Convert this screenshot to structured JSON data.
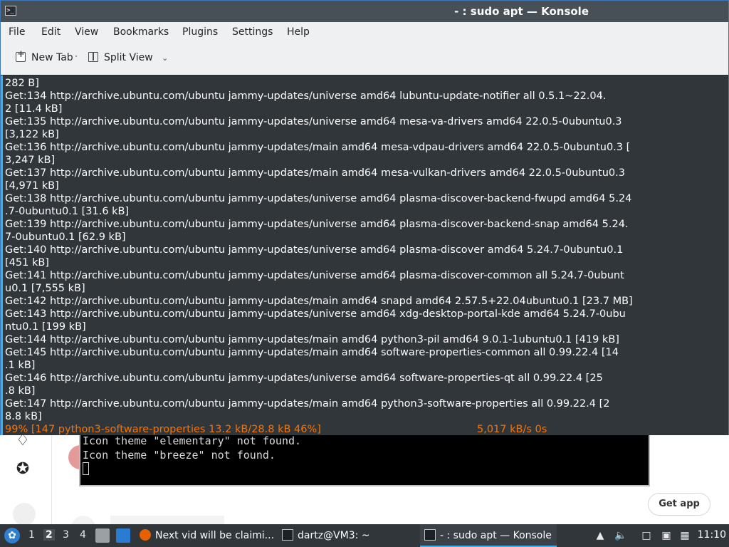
{
  "window": {
    "title": "- : sudo apt — Konsole",
    "app_icon": "terminal-icon"
  },
  "menu": [
    "File",
    "Edit",
    "View",
    "Bookmarks",
    "Plugins",
    "Settings",
    "Help"
  ],
  "toolbar": {
    "new_tab": "New Tab",
    "split_view": "Split View"
  },
  "terminal": {
    "lines": [
      "282 B]",
      "Get:134 http://archive.ubuntu.com/ubuntu jammy-updates/universe amd64 lubuntu-update-notifier all 0.5.1~22.04.",
      "2 [11.4 kB]",
      "Get:135 http://archive.ubuntu.com/ubuntu jammy-updates/universe amd64 mesa-va-drivers amd64 22.0.5-0ubuntu0.3",
      "[3,122 kB]",
      "Get:136 http://archive.ubuntu.com/ubuntu jammy-updates/main amd64 mesa-vdpau-drivers amd64 22.0.5-0ubuntu0.3 [",
      "3,247 kB]",
      "Get:137 http://archive.ubuntu.com/ubuntu jammy-updates/main amd64 mesa-vulkan-drivers amd64 22.0.5-0ubuntu0.3",
      "[4,971 kB]",
      "Get:138 http://archive.ubuntu.com/ubuntu jammy-updates/universe amd64 plasma-discover-backend-fwupd amd64 5.24",
      ".7-0ubuntu0.1 [31.6 kB]",
      "Get:139 http://archive.ubuntu.com/ubuntu jammy-updates/universe amd64 plasma-discover-backend-snap amd64 5.24.",
      "7-0ubuntu0.1 [62.9 kB]",
      "Get:140 http://archive.ubuntu.com/ubuntu jammy-updates/universe amd64 plasma-discover amd64 5.24.7-0ubuntu0.1",
      "[451 kB]",
      "Get:141 http://archive.ubuntu.com/ubuntu jammy-updates/universe amd64 plasma-discover-common all 5.24.7-0ubunt",
      "u0.1 [7,555 kB]",
      "Get:142 http://archive.ubuntu.com/ubuntu jammy-updates/main amd64 snapd amd64 2.57.5+22.04ubuntu0.1 [23.7 MB]",
      "Get:143 http://archive.ubuntu.com/ubuntu jammy-updates/universe amd64 xdg-desktop-portal-kde amd64 5.24.7-0ubu",
      "ntu0.1 [199 kB]",
      "Get:144 http://archive.ubuntu.com/ubuntu jammy-updates/main amd64 python3-pil amd64 9.0.1-1ubuntu0.1 [419 kB]",
      "Get:145 http://archive.ubuntu.com/ubuntu jammy-updates/main amd64 software-properties-common all 0.99.22.4 [14",
      ".1 kB]",
      "Get:146 http://archive.ubuntu.com/ubuntu jammy-updates/universe amd64 software-properties-qt all 0.99.22.4 [25",
      ".8 kB]",
      "Get:147 http://archive.ubuntu.com/ubuntu jammy-updates/main amd64 python3-software-properties all 0.99.22.4 [2",
      "8.8 kB]"
    ],
    "progress": "99% [147 python3-software-properties 13.2 kB/28.8 kB 46%]",
    "speed": "5,017 kB/s 0s",
    "progress_color": "#f67400"
  },
  "background_app": {
    "terminal_text": "Icon theme \"elementary\" not found.\nIcon theme \"breeze\" not found.",
    "get_app": "Get app",
    "rail_icons": [
      "badge-icon",
      "medal-icon"
    ]
  },
  "taskbar": {
    "desktops": [
      "1",
      "2",
      "3",
      "4"
    ],
    "active_desktop": "2",
    "tasks": [
      {
        "label": "Next vid will be claimi...",
        "icon": "firefox-icon"
      },
      {
        "label": "dartz@VM3: ~",
        "icon": "terminal-icon"
      },
      {
        "label": "- : sudo apt — Konsole",
        "icon": "terminal-icon"
      }
    ],
    "clock": "11:10"
  },
  "colors": {
    "titlebar": "#475057",
    "terminal_bg": "#31363b",
    "accent": "#3daee9"
  }
}
